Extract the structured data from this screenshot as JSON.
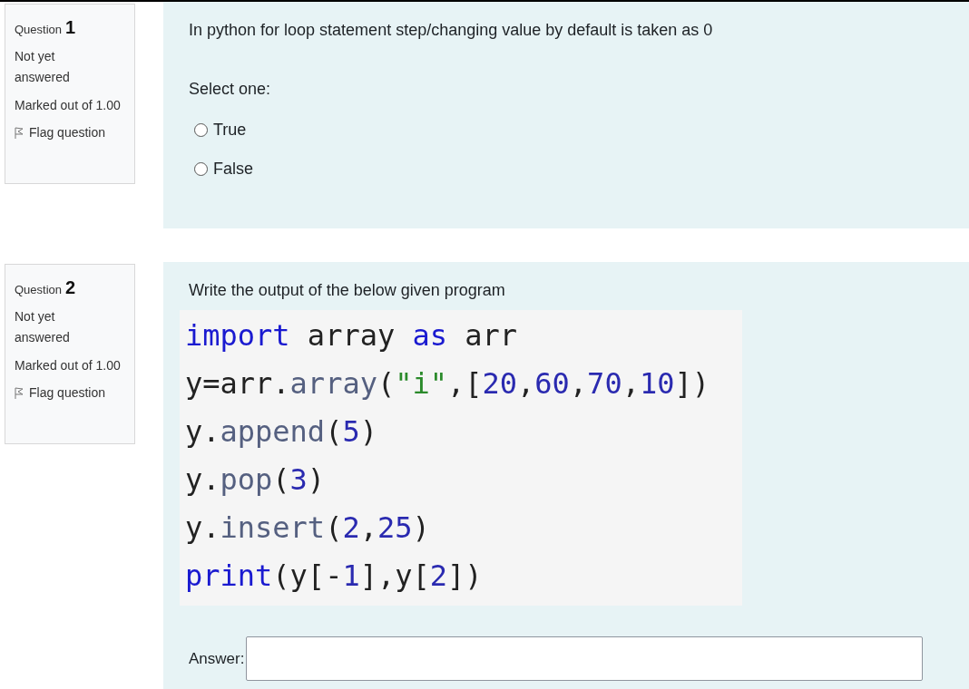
{
  "questions": [
    {
      "info": {
        "label": "Question",
        "number": "1",
        "state": "Not yet answered",
        "marks": "Marked out of 1.00",
        "flag": "Flag question"
      },
      "kind": "choice",
      "prompt": "In python for loop statement step/changing value by default is taken as 0",
      "select_label": "Select one:",
      "options": [
        {
          "label": "True",
          "selected": false
        },
        {
          "label": "False",
          "selected": false
        }
      ]
    },
    {
      "info": {
        "label": "Question",
        "number": "2",
        "state": "Not yet answered",
        "marks": "Marked out of 1.00",
        "flag": "Flag question"
      },
      "kind": "code",
      "prompt": "Write the output of the below given program",
      "code_lines": [
        [
          {
            "kind": "keyword",
            "text": "import"
          },
          {
            "kind": "plain",
            "text": " array "
          },
          {
            "kind": "keyword",
            "text": "as"
          },
          {
            "kind": "plain",
            "text": " arr"
          }
        ],
        [
          {
            "kind": "plain",
            "text": "y=arr."
          },
          {
            "kind": "attr",
            "text": "array"
          },
          {
            "kind": "plain",
            "text": "("
          },
          {
            "kind": "string",
            "text": "\"i\""
          },
          {
            "kind": "plain",
            "text": ",["
          },
          {
            "kind": "number",
            "text": "20"
          },
          {
            "kind": "plain",
            "text": ","
          },
          {
            "kind": "number",
            "text": "60"
          },
          {
            "kind": "plain",
            "text": ","
          },
          {
            "kind": "number",
            "text": "70"
          },
          {
            "kind": "plain",
            "text": ","
          },
          {
            "kind": "number",
            "text": "10"
          },
          {
            "kind": "plain",
            "text": "])"
          }
        ],
        [
          {
            "kind": "plain",
            "text": "y."
          },
          {
            "kind": "attr",
            "text": "append"
          },
          {
            "kind": "plain",
            "text": "("
          },
          {
            "kind": "number",
            "text": "5"
          },
          {
            "kind": "plain",
            "text": ")"
          }
        ],
        [
          {
            "kind": "plain",
            "text": "y."
          },
          {
            "kind": "attr",
            "text": "pop"
          },
          {
            "kind": "plain",
            "text": "("
          },
          {
            "kind": "number",
            "text": "3"
          },
          {
            "kind": "plain",
            "text": ")"
          }
        ],
        [
          {
            "kind": "plain",
            "text": "y."
          },
          {
            "kind": "attr",
            "text": "insert"
          },
          {
            "kind": "plain",
            "text": "("
          },
          {
            "kind": "number",
            "text": "2"
          },
          {
            "kind": "plain",
            "text": ","
          },
          {
            "kind": "number",
            "text": "25"
          },
          {
            "kind": "plain",
            "text": ")"
          }
        ],
        [
          {
            "kind": "keyword",
            "text": "print"
          },
          {
            "kind": "plain",
            "text": "(y["
          },
          {
            "kind": "plain",
            "text": "-"
          },
          {
            "kind": "number",
            "text": "1"
          },
          {
            "kind": "plain",
            "text": "],y["
          },
          {
            "kind": "number",
            "text": "2"
          },
          {
            "kind": "plain",
            "text": "])"
          }
        ]
      ],
      "answer_label": "Answer:"
    }
  ]
}
